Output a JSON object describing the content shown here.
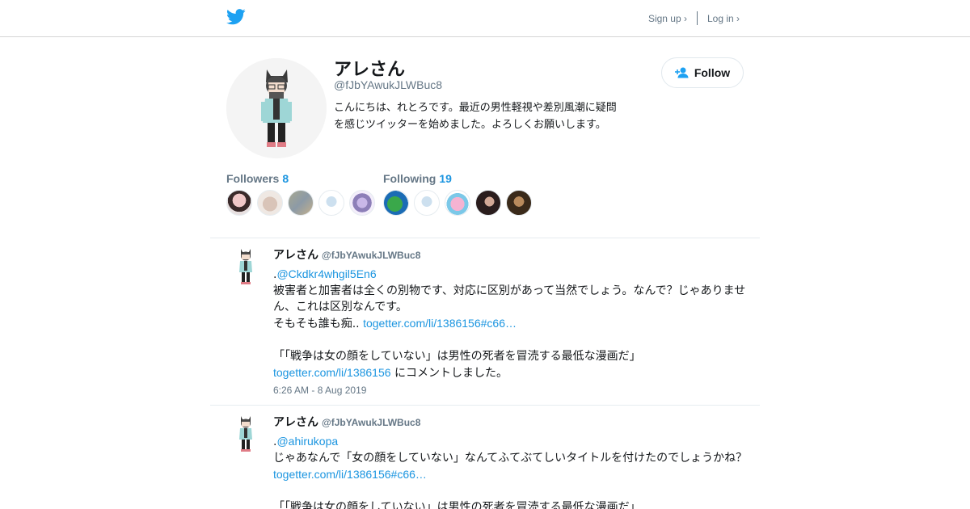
{
  "header": {
    "logo_icon": "twitter-bird-icon",
    "signup_label": "Sign up ›",
    "login_label": "Log in ›",
    "brand_color": "#1da1f2"
  },
  "profile": {
    "name": "アレさん",
    "handle": "@fJbYAwukJLWBuc8",
    "bio_line1": "こんにちは、れとろです。最近の男性軽視や差別風潮に疑問",
    "bio_line2": "を感じツイッターを始めました。よろしくお願いします。",
    "follow_label": "Follow",
    "follow_icon": "add-user-icon"
  },
  "stats": {
    "followers_label": "Followers",
    "followers_count": "8",
    "following_label": "Following",
    "following_count": "19"
  },
  "tweets": [
    {
      "name": "アレさん",
      "handle": "@fJbYAwukJLWBuc8",
      "mention_prefix": ".",
      "mention": "@Ckdkr4whgil5En6",
      "text1": "被害者と加害者は全くの別物です、対応に区別があって当然でしょう。なんで？じゃありませ",
      "text2": "ん、これは区別なんです。",
      "text3": "そもそも誰も痴.. ",
      "link1": "togetter.com/li/1386156#c66…",
      "quote": "「「戦争は女の顔をしていない」は男性の死者を冒涜する最低な漫画だ」",
      "link2": "togetter.com/li/1386156",
      "suffix": " にコメントしました。",
      "time": "6:26 AM - 8 Aug 2019"
    },
    {
      "name": "アレさん",
      "handle": "@fJbYAwukJLWBuc8",
      "mention_prefix": ".",
      "mention": "@ahirukopa",
      "text1": "じゃあなんで「女の顔をしていない」なんてふてぶてしいタイトルを付けたのでしょうかね？",
      "link1": "togetter.com/li/1386156#c66…",
      "quote": "「「戦争は女の顔をしていない」は男性の死者を冒涜する最低な漫画だ」"
    }
  ]
}
